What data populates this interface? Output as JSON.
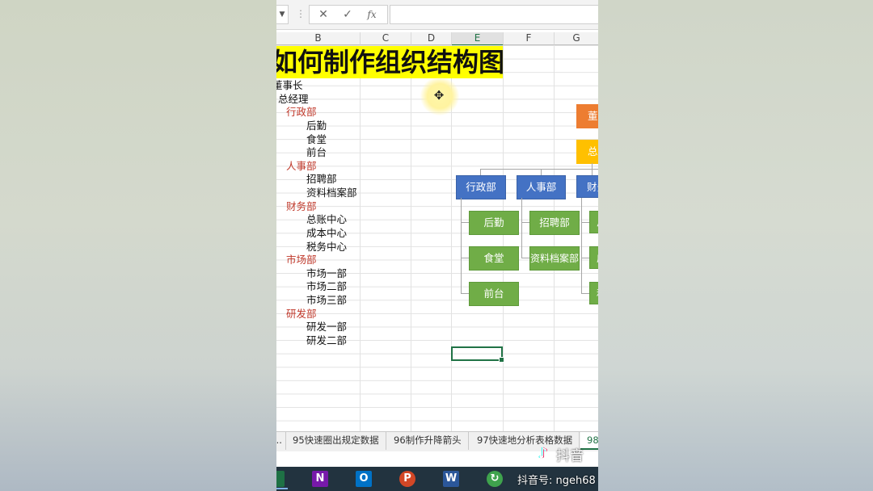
{
  "formula_bar": {
    "cancel_icon": "✕",
    "enter_icon": "✓",
    "fx_label": "fx"
  },
  "columns": [
    "B",
    "C",
    "D",
    "E",
    "F",
    "G"
  ],
  "selected_column": "E",
  "title": "如何制作组织结构图",
  "outline": [
    {
      "text": "董事长",
      "level": 0,
      "red": false
    },
    {
      "text": "总经理",
      "level": 1,
      "red": false
    },
    {
      "text": "行政部",
      "level": 2,
      "red": true
    },
    {
      "text": "后勤",
      "level": 3,
      "red": false
    },
    {
      "text": "食堂",
      "level": 3,
      "red": false
    },
    {
      "text": "前台",
      "level": 3,
      "red": false
    },
    {
      "text": "人事部",
      "level": 2,
      "red": true
    },
    {
      "text": "招聘部",
      "level": 3,
      "red": false
    },
    {
      "text": "资料档案部",
      "level": 3,
      "red": false
    },
    {
      "text": "财务部",
      "level": 2,
      "red": true
    },
    {
      "text": "总账中心",
      "level": 3,
      "red": false
    },
    {
      "text": "成本中心",
      "level": 3,
      "red": false
    },
    {
      "text": "税务中心",
      "level": 3,
      "red": false
    },
    {
      "text": "市场部",
      "level": 2,
      "red": true
    },
    {
      "text": "市场一部",
      "level": 3,
      "red": false
    },
    {
      "text": "市场二部",
      "level": 3,
      "red": false
    },
    {
      "text": "市场三部",
      "level": 3,
      "red": false
    },
    {
      "text": "研发部",
      "level": 2,
      "red": true
    },
    {
      "text": "研发一部",
      "level": 3,
      "red": false
    },
    {
      "text": "研发二部",
      "level": 3,
      "red": false
    }
  ],
  "org_chart": {
    "top_box": "董事长",
    "second_box": "总经理",
    "departments": [
      "行政部",
      "人事部",
      "财务部"
    ],
    "admin_children": [
      "后勤",
      "食堂",
      "前台"
    ],
    "hr_children": [
      "招聘部",
      "资料档案部"
    ],
    "finance_children": [
      "总账中心",
      "成本中心",
      "税务中心"
    ]
  },
  "sheet_tabs": [
    {
      "label": "..."
    },
    {
      "label": "95快速圈出规定数据"
    },
    {
      "label": "96制作升降箭头"
    },
    {
      "label": "97快速地分析表格数据"
    },
    {
      "label": "98"
    }
  ],
  "taskbar_apps": [
    {
      "name": "excel-icon",
      "letter": "X",
      "color": "#1e7145"
    },
    {
      "name": "onenote-icon",
      "letter": "N",
      "color": "#7719aa"
    },
    {
      "name": "outlook-icon",
      "letter": "O",
      "color": "#0072c6"
    },
    {
      "name": "powerpoint-icon",
      "letter": "P",
      "color": "#d24726"
    },
    {
      "name": "word-icon",
      "letter": "W",
      "color": "#2b579a"
    },
    {
      "name": "green-app-icon",
      "letter": "↻",
      "color": "#3fa34d"
    }
  ],
  "watermark": {
    "brand": "抖音",
    "account": "抖音号: ngeh68"
  }
}
